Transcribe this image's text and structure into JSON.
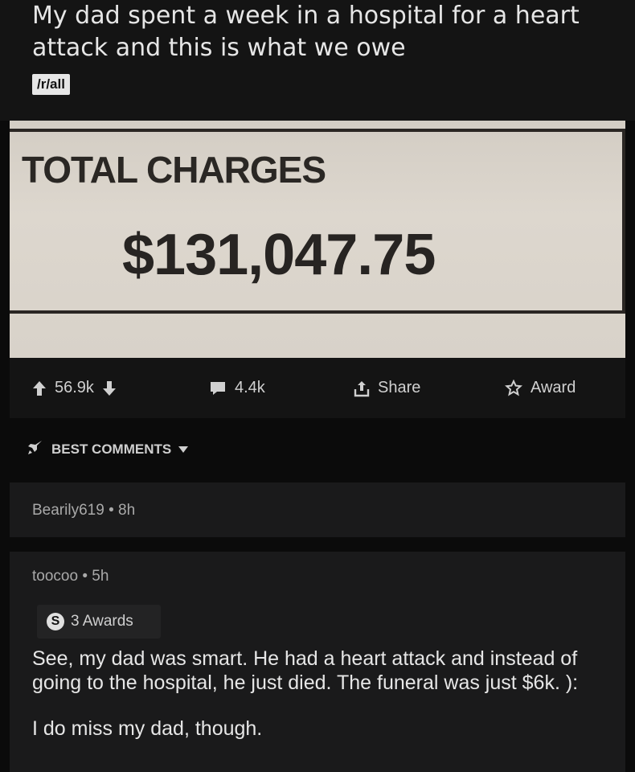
{
  "post": {
    "title": "My dad spent a week in a hospital for a heart attack and this is what we owe",
    "subreddit": "/r/all"
  },
  "photo": {
    "label": "TOTAL CHARGES",
    "amount": "$131,047.75"
  },
  "actions": {
    "upvotes": "56.9k",
    "comments": "4.4k",
    "share": "Share",
    "award": "Award"
  },
  "sort": {
    "label": "BEST COMMENTS"
  },
  "comments": [
    {
      "author": "Bearily619",
      "age": "8h"
    },
    {
      "author": "toocoo",
      "age": "5h",
      "awards": "3 Awards",
      "paragraphs": [
        "See, my dad was smart. He had a heart attack and instead of going to the hospital, he just died. The funeral was just $6k. ):",
        "I do miss my dad, though."
      ]
    }
  ],
  "colors": {
    "background": "#0b0b0b",
    "card": "#1a1a1b",
    "text": "#e6e6e6",
    "muted": "#a9a9a9",
    "paper": "#d8d2c9"
  }
}
